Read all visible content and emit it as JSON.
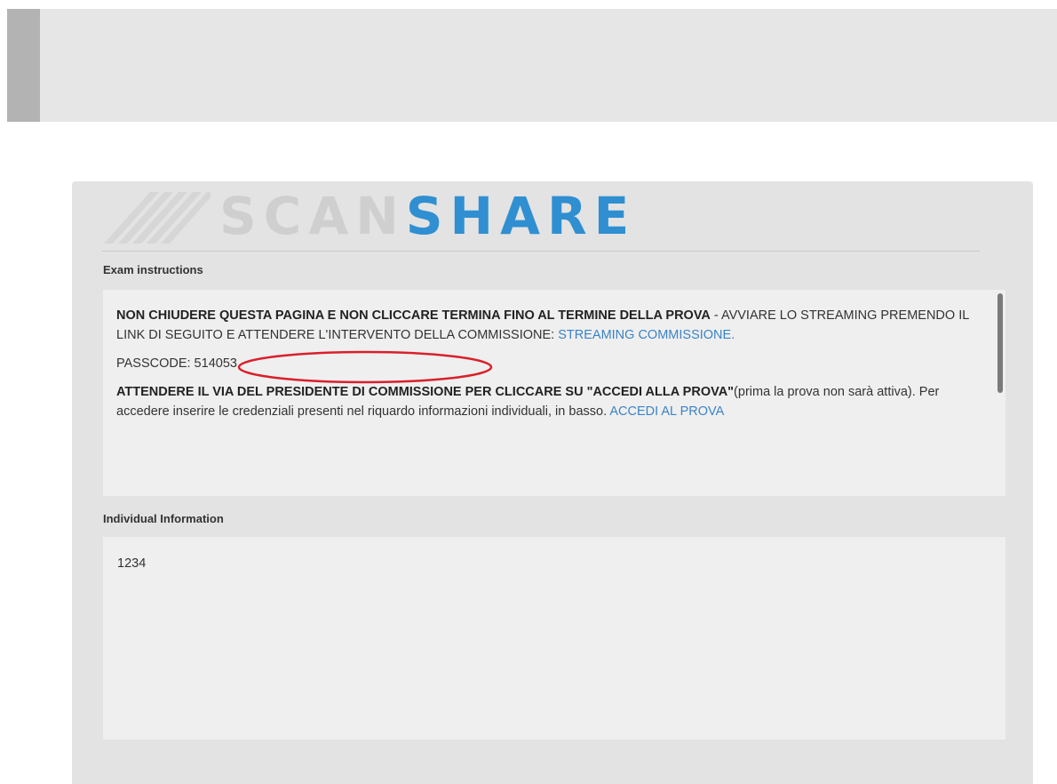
{
  "header": {
    "accent_color": "#b3b3b3",
    "background_color": "#e6e6e6"
  },
  "logo": {
    "part1": "SCAN",
    "part2": "SHARE",
    "part1_color": "#cfcfcf",
    "part2_color": "#2f8fd1",
    "icon": "stripes-icon"
  },
  "exam_instructions": {
    "label": "Exam instructions",
    "para1_bold": "NON CHIUDERE QUESTA PAGINA  E NON CLICCARE TERMINA FINO AL TERMINE DELLA PROVA",
    "para1_text": " - AVVIARE LO STREAMING PREMENDO IL LINK DI SEGUITO E ATTENDERE L'INTERVENTO DELLA COMMISSIONE: ",
    "streaming_link": "STREAMING COMMISSIONE.",
    "passcode": "PASSCODE: 514053",
    "para3_bold": "ATTENDERE IL VIA DEL PRESIDENTE DI COMMISSIONE PER CLICCARE SU \"ACCEDI ALLA PROVA\"",
    "para3_text": "(prima la prova non sarà attiva). Per accedere inserire le credenziali presenti nel riquardo informazioni individuali, in basso. ",
    "accedi_link": "ACCEDI AL PROVA",
    "highlight_color": "#d9202a",
    "link_color": "#3a84c8"
  },
  "individual_information": {
    "label": "Individual Information",
    "value": "1234"
  }
}
